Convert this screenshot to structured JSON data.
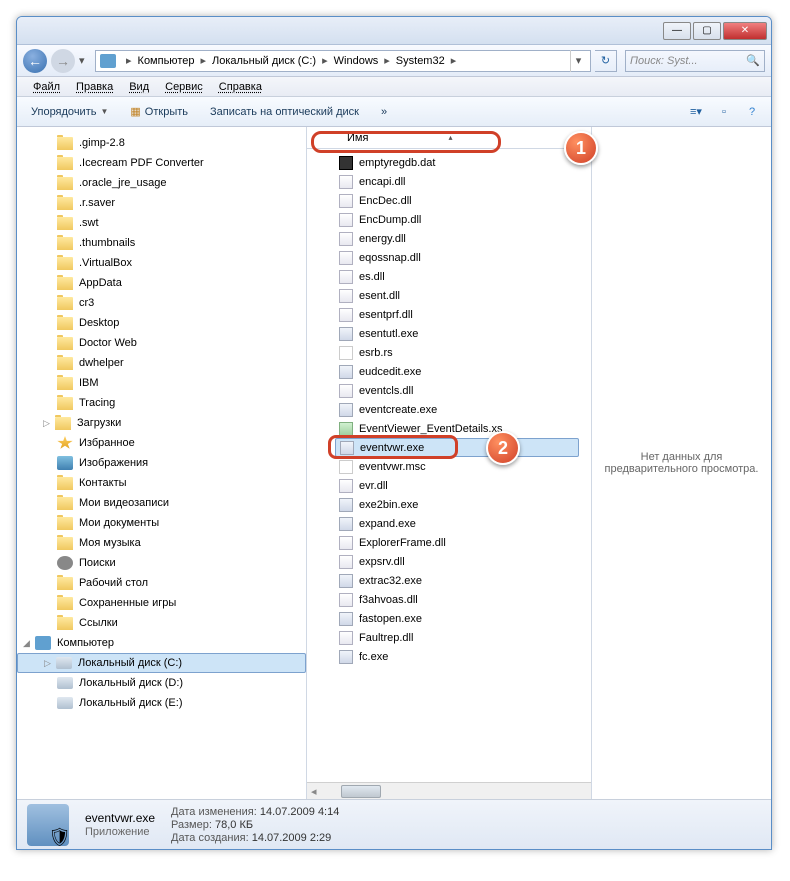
{
  "titlebar": {
    "min": "—",
    "max": "▢",
    "close": "✕"
  },
  "nav": {
    "crumbs": [
      "Компьютер",
      "Локальный диск (C:)",
      "Windows",
      "System32"
    ],
    "search_placeholder": "Поиск: Syst..."
  },
  "menubar": [
    "Файл",
    "Правка",
    "Вид",
    "Сервис",
    "Справка"
  ],
  "toolbar": {
    "organize": "Упорядочить",
    "open": "Открыть",
    "burn": "Записать на оптический диск",
    "more": "»"
  },
  "column": {
    "name": "Имя"
  },
  "sidebar": [
    {
      "label": ".gimp-2.8",
      "type": "folder"
    },
    {
      "label": ".Icecream PDF Converter",
      "type": "folder"
    },
    {
      "label": ".oracle_jre_usage",
      "type": "folder"
    },
    {
      "label": ".r.saver",
      "type": "folder"
    },
    {
      "label": ".swt",
      "type": "folder"
    },
    {
      "label": ".thumbnails",
      "type": "folder"
    },
    {
      "label": ".VirtualBox",
      "type": "folder"
    },
    {
      "label": "AppData",
      "type": "folder"
    },
    {
      "label": "cr3",
      "type": "folder"
    },
    {
      "label": "Desktop",
      "type": "folder"
    },
    {
      "label": "Doctor Web",
      "type": "folder"
    },
    {
      "label": "dwhelper",
      "type": "folder"
    },
    {
      "label": "IBM",
      "type": "folder"
    },
    {
      "label": "Tracing",
      "type": "folder"
    },
    {
      "label": "Загрузки",
      "type": "folder-exp"
    },
    {
      "label": "Избранное",
      "type": "fav"
    },
    {
      "label": "Изображения",
      "type": "img"
    },
    {
      "label": "Контакты",
      "type": "folder"
    },
    {
      "label": "Мои видеозаписи",
      "type": "folder"
    },
    {
      "label": "Мои документы",
      "type": "folder"
    },
    {
      "label": "Моя музыка",
      "type": "folder"
    },
    {
      "label": "Поиски",
      "type": "search"
    },
    {
      "label": "Рабочий стол",
      "type": "folder"
    },
    {
      "label": "Сохраненные игры",
      "type": "folder"
    },
    {
      "label": "Ссылки",
      "type": "folder"
    }
  ],
  "sidebar_computer": {
    "root": "Компьютер",
    "drives": [
      "Локальный диск (C:)",
      "Локальный диск (D:)",
      "Локальный диск (E:)"
    ]
  },
  "files": [
    {
      "name": "emptyregdb.dat",
      "icon": "dat"
    },
    {
      "name": "encapi.dll",
      "icon": "dll"
    },
    {
      "name": "EncDec.dll",
      "icon": "dll"
    },
    {
      "name": "EncDump.dll",
      "icon": "dll"
    },
    {
      "name": "energy.dll",
      "icon": "dll"
    },
    {
      "name": "eqossnap.dll",
      "icon": "dll"
    },
    {
      "name": "es.dll",
      "icon": "dll"
    },
    {
      "name": "esent.dll",
      "icon": "dll"
    },
    {
      "name": "esentprf.dll",
      "icon": "dll"
    },
    {
      "name": "esentutl.exe",
      "icon": "exe"
    },
    {
      "name": "esrb.rs",
      "icon": "gen"
    },
    {
      "name": "eudcedit.exe",
      "icon": "exe"
    },
    {
      "name": "eventcls.dll",
      "icon": "dll"
    },
    {
      "name": "eventcreate.exe",
      "icon": "exe"
    },
    {
      "name": "EventViewer_EventDetails.xs",
      "icon": "xsl"
    },
    {
      "name": "eventvwr.exe",
      "icon": "exe",
      "selected": true
    },
    {
      "name": "eventvwr.msc",
      "icon": "gen"
    },
    {
      "name": "evr.dll",
      "icon": "dll"
    },
    {
      "name": "exe2bin.exe",
      "icon": "exe"
    },
    {
      "name": "expand.exe",
      "icon": "exe"
    },
    {
      "name": "ExplorerFrame.dll",
      "icon": "dll"
    },
    {
      "name": "expsrv.dll",
      "icon": "dll"
    },
    {
      "name": "extrac32.exe",
      "icon": "exe"
    },
    {
      "name": "f3ahvoas.dll",
      "icon": "dll"
    },
    {
      "name": "fastopen.exe",
      "icon": "exe"
    },
    {
      "name": "Faultrep.dll",
      "icon": "dll"
    },
    {
      "name": "fc.exe",
      "icon": "exe"
    }
  ],
  "preview": "Нет данных для предварительного просмотра.",
  "status": {
    "filename": "eventvwr.exe",
    "type": "Приложение",
    "modified_lbl": "Дата изменения:",
    "modified_val": "14.07.2009 4:14",
    "size_lbl": "Размер:",
    "size_val": "78,0 КБ",
    "created_lbl": "Дата создания:",
    "created_val": "14.07.2009 2:29"
  },
  "badges": {
    "b1": "1",
    "b2": "2"
  }
}
